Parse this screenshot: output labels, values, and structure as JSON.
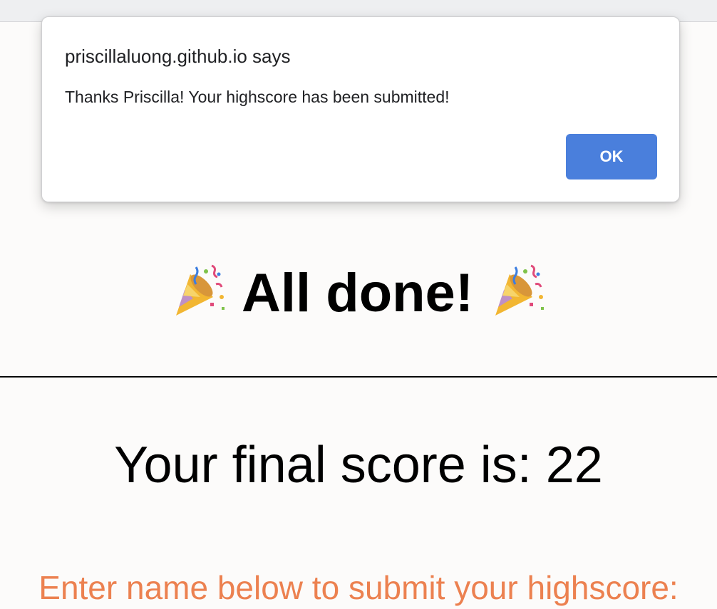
{
  "dialog": {
    "title": "priscillaluong.github.io says",
    "message": "Thanks Priscilla! Your highscore has been submitted!",
    "ok_label": "OK"
  },
  "main": {
    "headline": "All done!",
    "headline_icon": "party-popper-icon",
    "score_text": "Your final score is: 22",
    "prompt": "Enter name below to submit your highscore:"
  },
  "colors": {
    "prompt": "#ec8150",
    "ok_button": "#4a7fdc",
    "background": "#fcfbfa"
  }
}
